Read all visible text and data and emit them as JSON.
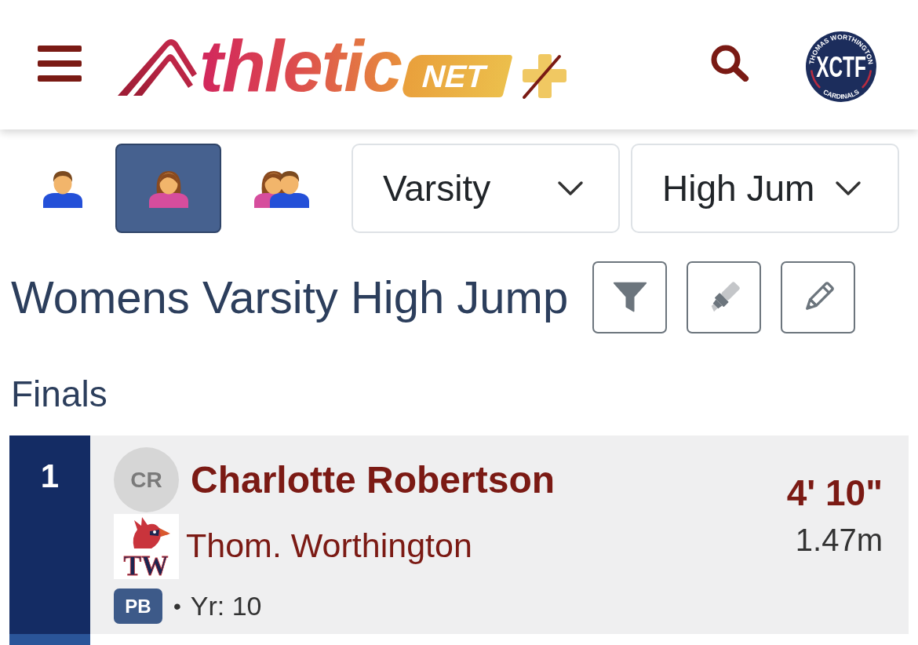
{
  "header": {
    "logo": {
      "wordmark": "thletic",
      "tag": "NET"
    },
    "team_logo": {
      "top_arc": "THOMAS WORTHINGTON",
      "center": "XCTF",
      "bottom_arc": "CARDINALS"
    }
  },
  "gender_filter": [
    {
      "kind": "male",
      "selected": false
    },
    {
      "kind": "female",
      "selected": true
    },
    {
      "kind": "mixed",
      "selected": false
    }
  ],
  "dropdowns": [
    {
      "value": "Varsity"
    },
    {
      "value": "High Jum"
    }
  ],
  "title": "Womens Varsity High Jump",
  "tools": [
    {
      "kind": "filter"
    },
    {
      "kind": "highlight"
    },
    {
      "kind": "edit"
    }
  ],
  "section": "Finals",
  "results": [
    {
      "place": "1",
      "initials": "CR",
      "athlete": "Charlotte Robertson",
      "school_logo": "TW",
      "school": "Thom. Worthington",
      "badge": "PB",
      "separator": "•",
      "grade": "Yr: 10",
      "mark": "4' 10\"",
      "metric": "1.47m"
    }
  ]
}
